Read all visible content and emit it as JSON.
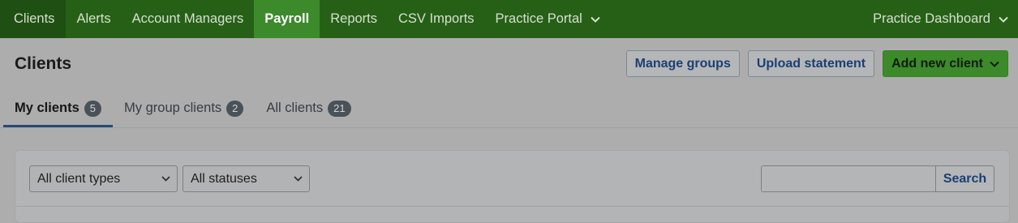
{
  "topnav": {
    "items": [
      {
        "label": "Clients"
      },
      {
        "label": "Alerts"
      },
      {
        "label": "Account Managers"
      },
      {
        "label": "Payroll"
      },
      {
        "label": "Reports"
      },
      {
        "label": "CSV Imports"
      },
      {
        "label": "Practice Portal"
      }
    ],
    "active": "Payroll",
    "right_label": "Practice Dashboard",
    "colors": {
      "bar": "#266016",
      "active": "#3c8a2c"
    }
  },
  "header": {
    "title": "Clients",
    "actions": {
      "manage_groups": "Manage groups",
      "upload_statement": "Upload statement",
      "add_new_client": "Add new client"
    }
  },
  "tabs": [
    {
      "label": "My clients",
      "count": "5"
    },
    {
      "label": "My group clients",
      "count": "2"
    },
    {
      "label": "All clients",
      "count": "21"
    }
  ],
  "filters": {
    "client_type": "All client types",
    "status": "All statuses"
  },
  "search": {
    "value": "",
    "button_label": "Search"
  }
}
